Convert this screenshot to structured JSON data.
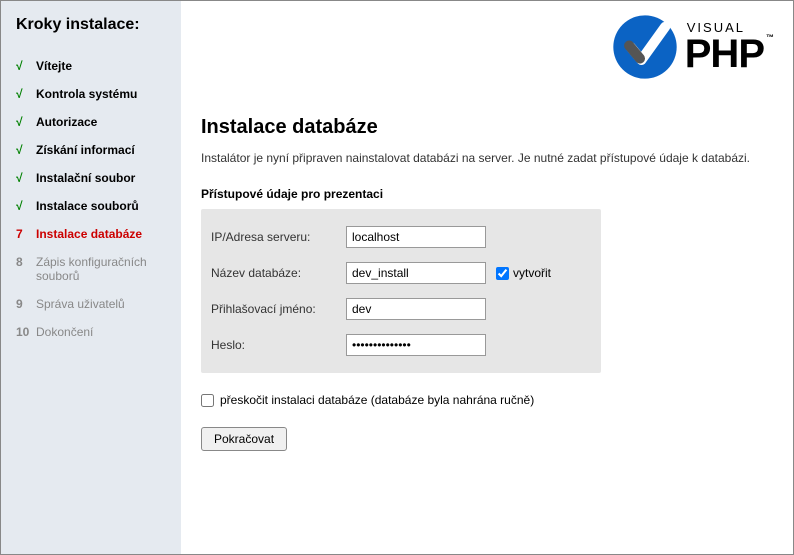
{
  "sidebar": {
    "title": "Kroky instalace:",
    "steps": [
      {
        "mark": "√",
        "label": "Vítejte",
        "state": "done"
      },
      {
        "mark": "√",
        "label": "Kontrola systému",
        "state": "done"
      },
      {
        "mark": "√",
        "label": "Autorizace",
        "state": "done"
      },
      {
        "mark": "√",
        "label": "Získání informací",
        "state": "done"
      },
      {
        "mark": "√",
        "label": "Instalační soubor",
        "state": "done"
      },
      {
        "mark": "√",
        "label": "Instalace souborů",
        "state": "done"
      },
      {
        "mark": "7",
        "label": "Instalace databáze",
        "state": "current"
      },
      {
        "mark": "8",
        "label": "Zápis konfiguračních souborů",
        "state": "future"
      },
      {
        "mark": "9",
        "label": "Správa uživatelů",
        "state": "future"
      },
      {
        "mark": "10",
        "label": "Dokončení",
        "state": "future"
      }
    ]
  },
  "logo": {
    "small": "VISUAL",
    "big": "PHP",
    "tm": "™"
  },
  "heading": "Instalace databáze",
  "description": "Instalátor je nyní připraven nainstalovat databázi na server. Je nutné zadat přístupové údaje k databázi.",
  "section_title": "Přístupové údaje pro prezentaci",
  "form": {
    "server": {
      "label": "IP/Adresa serveru:",
      "value": "localhost"
    },
    "dbname": {
      "label": "Název databáze:",
      "value": "dev_install"
    },
    "create": {
      "label": "vytvořit",
      "checked": true
    },
    "login": {
      "label": "Přihlašovací jméno:",
      "value": "dev"
    },
    "password": {
      "label": "Heslo:",
      "value": "••••••••••••••"
    }
  },
  "skip": {
    "label": "přeskočit instalaci databáze (databáze byla nahrána ručně)",
    "checked": false
  },
  "button": {
    "continue": "Pokračovat"
  }
}
